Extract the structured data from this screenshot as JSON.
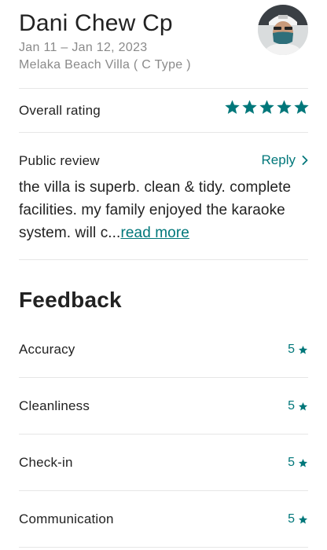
{
  "guest": {
    "name": "Dani Chew Cp",
    "dates": "Jan 11 – Jan 12, 2023",
    "listing": "Melaka Beach Villa ( C Type )"
  },
  "overall": {
    "label": "Overall rating",
    "rating": 5,
    "max": 5,
    "star_icon": "star-icon",
    "color": "#00777a"
  },
  "review": {
    "label": "Public review",
    "reply_label": "Reply",
    "reply_icon": "chevron-right-icon",
    "text": "the villa is superb. clean & tidy. complete facilities. my family enjoyed the karaoke system. will c...",
    "read_more": "read more"
  },
  "feedback": {
    "title": "Feedback",
    "items": [
      {
        "label": "Accuracy",
        "score": "5"
      },
      {
        "label": "Cleanliness",
        "score": "5"
      },
      {
        "label": "Check-in",
        "score": "5"
      },
      {
        "label": "Communication",
        "score": "5"
      }
    ]
  },
  "colors": {
    "accent": "#00777a",
    "text": "#222222",
    "muted": "#8a8a8a",
    "divider": "#e6e6e6"
  }
}
